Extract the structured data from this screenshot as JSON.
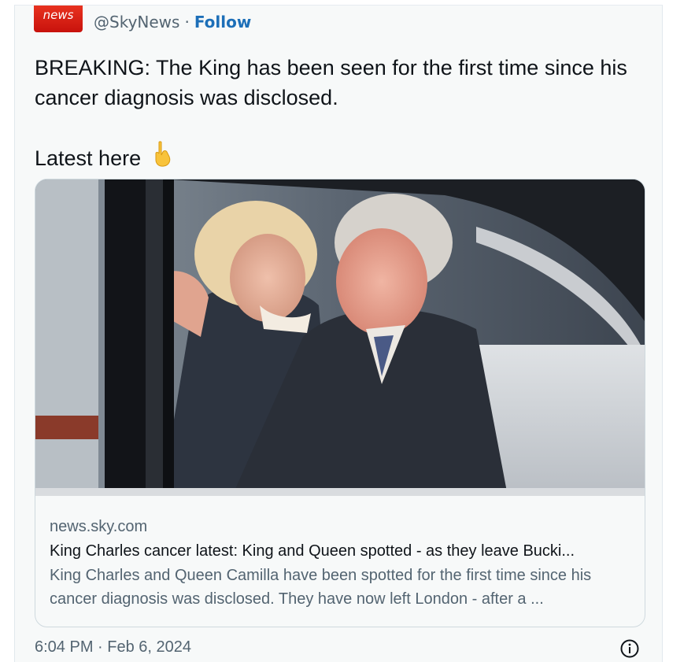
{
  "account": {
    "logo_text": "news",
    "handle": "@SkyNews",
    "separator": "·",
    "follow_label": "Follow"
  },
  "tweet": {
    "text": "BREAKING: The King has been seen for the first time since his cancer diagnosis was disclosed.",
    "latest_text": "Latest here",
    "emoji_icon": "backhand-index-pointing-down-icon",
    "timestamp": "6:04 PM · Feb 6, 2024"
  },
  "link_card": {
    "domain": "news.sky.com",
    "headline": "King Charles cancer latest: King and Queen spotted - as they leave Bucki...",
    "description": "King Charles and Queen Camilla have been spotted for the first time since his cancer diagnosis was disclosed. They have now left London - after a ..."
  },
  "colors": {
    "brand_red": "#d41e15",
    "link_blue": "#1d6fb8",
    "text_primary": "#0f1419",
    "text_secondary": "#536471"
  }
}
